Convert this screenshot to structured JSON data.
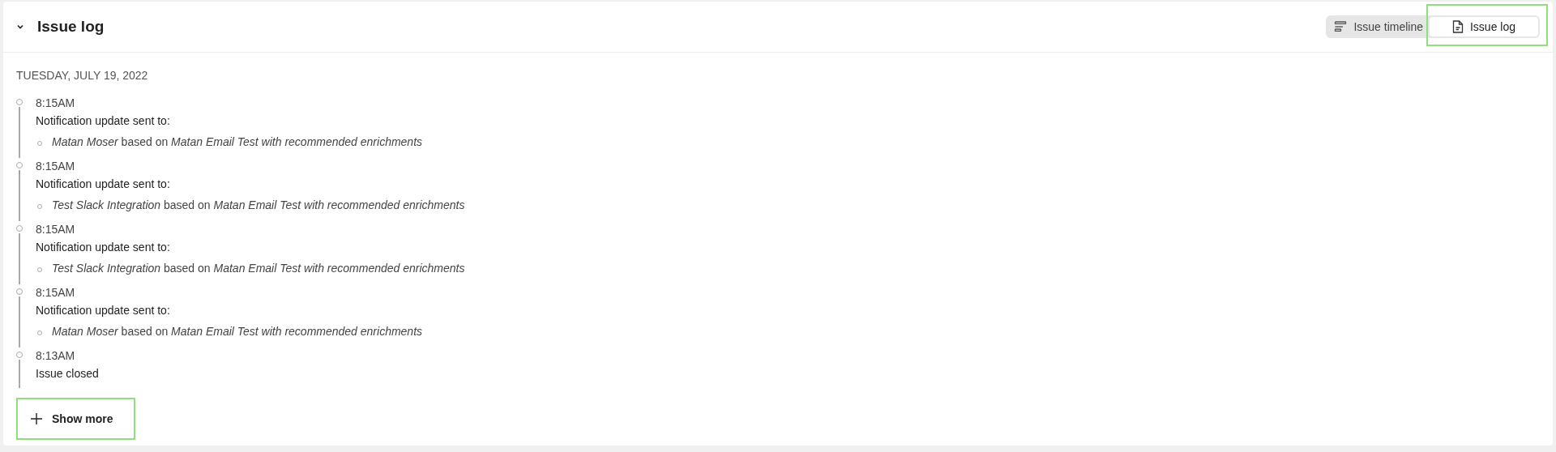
{
  "panel": {
    "title": "Issue log",
    "expanded": true
  },
  "view_tabs": [
    {
      "label": "Issue timeline",
      "kind": "timeline",
      "selected": false
    },
    {
      "label": "Issue log",
      "kind": "log",
      "selected": true
    }
  ],
  "selected_tab_highlighted": true,
  "date": "TUESDAY, JULY 19, 2022",
  "entries": [
    {
      "time": "8:15AM",
      "text": "Notification update sent to:",
      "recipients": [
        "*Matan Moser* based on *Matan Email Test with recommended enrichments*"
      ]
    },
    {
      "time": "8:15AM",
      "text": "Notification update sent to:",
      "recipients": [
        "*Test Slack Integration* based on *Matan Email Test with recommended enrichments*"
      ]
    },
    {
      "time": "8:15AM",
      "text": "Notification update sent to:",
      "recipients": [
        "*Test Slack Integration* based on *Matan Email Test with recommended enrichments*"
      ]
    },
    {
      "time": "8:15AM",
      "text": "Notification update sent to:",
      "recipients": [
        "*Matan Moser* based on *Matan Email Test with recommended enrichments*"
      ]
    },
    {
      "time": "8:13AM",
      "text": "Issue closed"
    }
  ],
  "show_more": {
    "label": "Show more",
    "highlighted": true
  }
}
